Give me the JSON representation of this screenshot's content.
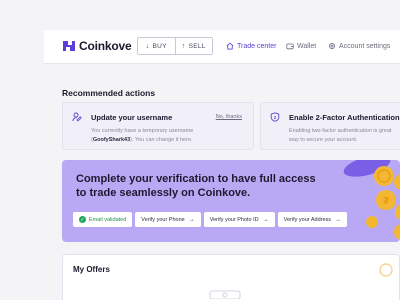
{
  "brand": {
    "name": "Coinkove"
  },
  "trade": {
    "buy_label": "BUY",
    "sell_label": "SELL"
  },
  "nav": {
    "trade_center": "Trade center",
    "wallet": "Wallet",
    "account_settings": "Account settings"
  },
  "recommended": {
    "title": "Recommended actions",
    "cards": [
      {
        "title": "Update your username",
        "desc_line1": "You currently have a temporary username",
        "username": "GoofyShark43",
        "desc_line2_suffix": "You can change it here.",
        "link": "No, thanks",
        "icon": "user-edit-icon"
      },
      {
        "title": "Enable 2-Factor Authentication",
        "desc_line1": "Enabling two-factor authentication is great",
        "desc_line2": "way to secure your account.",
        "icon": "shield-icon"
      }
    ]
  },
  "verification": {
    "title": "Complete your verification to have full access to trade seamlessly on Coinkove.",
    "chips": [
      {
        "label": "Email validated",
        "done": true
      },
      {
        "label": "Verify your Phone",
        "done": false
      },
      {
        "label": "Verify your Photo ID",
        "done": false
      },
      {
        "label": "Verify your Address",
        "done": false
      }
    ]
  },
  "offers": {
    "title": "My Offers"
  },
  "colors": {
    "accent": "#5b3fd6",
    "banner": "#b9a9f5",
    "success": "#22a55b",
    "coin": "#f4b731"
  }
}
